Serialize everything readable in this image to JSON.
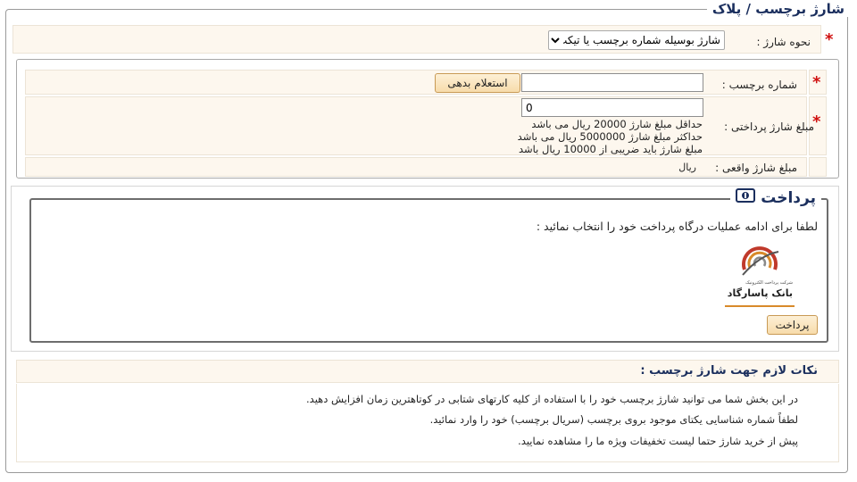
{
  "page": {
    "legend": "شارژ برچسب / پلاک"
  },
  "charge_method": {
    "label": "نحوه شارژ :",
    "selected": "شارژ بوسیله شماره برچسب یا تیکت"
  },
  "tag_number": {
    "label": "شماره برچسب :",
    "value": "",
    "inquiry_button": "استعلام بدهی"
  },
  "payment_amount": {
    "label": "مبلغ شارژ پرداختی :",
    "value": "0",
    "hints": [
      "حداقل مبلغ شارژ 20000 ریال می باشد",
      "حداکثر مبلغ شارژ 5000000 ریال می باشد",
      "مبلغ شارژ باید ضریبی از 10000 ریال باشد"
    ]
  },
  "actual_amount": {
    "label": "مبلغ شارژ واقعی :",
    "unit": "ریال"
  },
  "payment": {
    "legend": "پرداخت",
    "instruction": "لطفا برای ادامه عملیات درگاه پرداخت خود را انتخاب نمائید :",
    "gateway_small": "شرکت پرداخت الکترونیک",
    "gateway_name": "بانک پاسارگاد",
    "pay_button": "پرداخت"
  },
  "notes": {
    "title": "نکات لازم جهت شارژ برچسب :",
    "items": [
      "در این بخش شما می توانید شارژ برچسب خود را با استفاده از کلیه کارتهای شتابی در کوتاهترین زمان افزایش دهید.",
      "لطفاً شماره شناسایی یکتای موجود بروی برچسب (سریال برچسب) خود را وارد نمائید.",
      "پیش از خرید شارژ حتما لیست تخفیفات ویژه ما را مشاهده نمایید."
    ]
  },
  "colors": {
    "accent": "#1b2f5e",
    "required": "#d01010",
    "row_bg": "#fdf7ee",
    "button_bg": "#f7dcab"
  }
}
